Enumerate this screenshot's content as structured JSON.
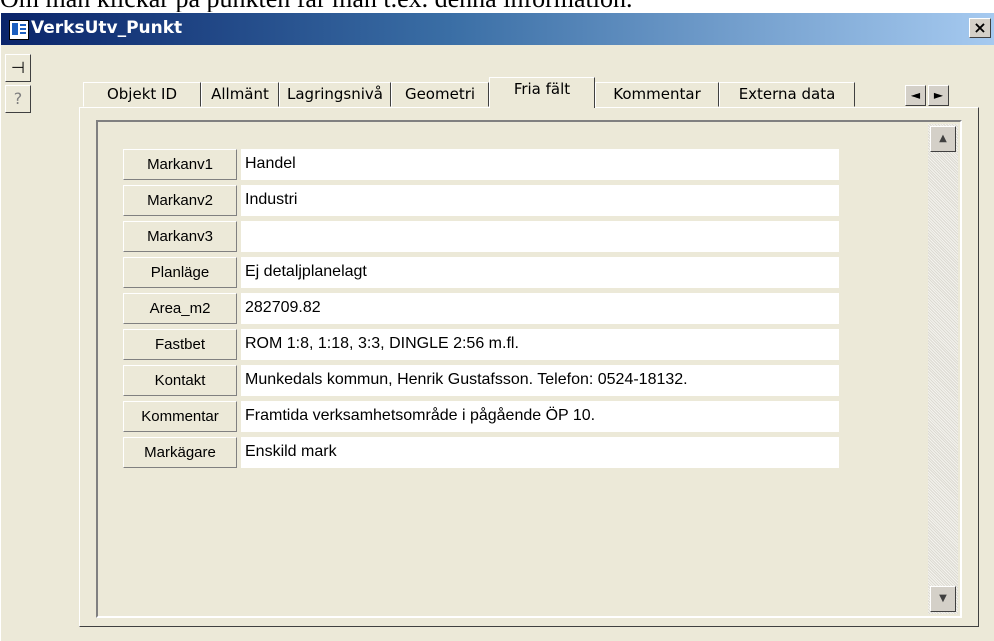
{
  "caption": "Om man klickar på punkten får man t.ex. denna information.",
  "window": {
    "title": "VerksUtv_Punkt",
    "close_label": "×"
  },
  "sidebar": {
    "pin_glyph": "⊣",
    "help_glyph": "?"
  },
  "tabs": [
    {
      "label": "Objekt ID",
      "active": false
    },
    {
      "label": "Allmänt",
      "active": false
    },
    {
      "label": "Lagringsnivå",
      "active": false
    },
    {
      "label": "Geometri",
      "active": false
    },
    {
      "label": "Fria fält",
      "active": true
    },
    {
      "label": "Kommentar",
      "active": false
    },
    {
      "label": "Externa data",
      "active": false
    }
  ],
  "tab_scroll": {
    "left": "◄",
    "right": "►"
  },
  "scrollbar": {
    "up": "▲",
    "down": "▼"
  },
  "fields": [
    {
      "label": "Markanv1",
      "value": "Handel"
    },
    {
      "label": "Markanv2",
      "value": "Industri"
    },
    {
      "label": "Markanv3",
      "value": ""
    },
    {
      "label": "Planläge",
      "value": "Ej detaljplanelagt"
    },
    {
      "label": "Area_m2",
      "value": "282709.82"
    },
    {
      "label": "Fastbet",
      "value": "ROM 1:8, 1:18, 3:3, DINGLE 2:56 m.fl."
    },
    {
      "label": "Kontakt",
      "value": "Munkedals kommun, Henrik Gustafsson. Telefon: 0524-18132."
    },
    {
      "label": "Kommentar",
      "value": "Framtida verksamhetsområde i pågående ÖP 10."
    },
    {
      "label": "Markägare",
      "value": "Enskild mark"
    }
  ]
}
